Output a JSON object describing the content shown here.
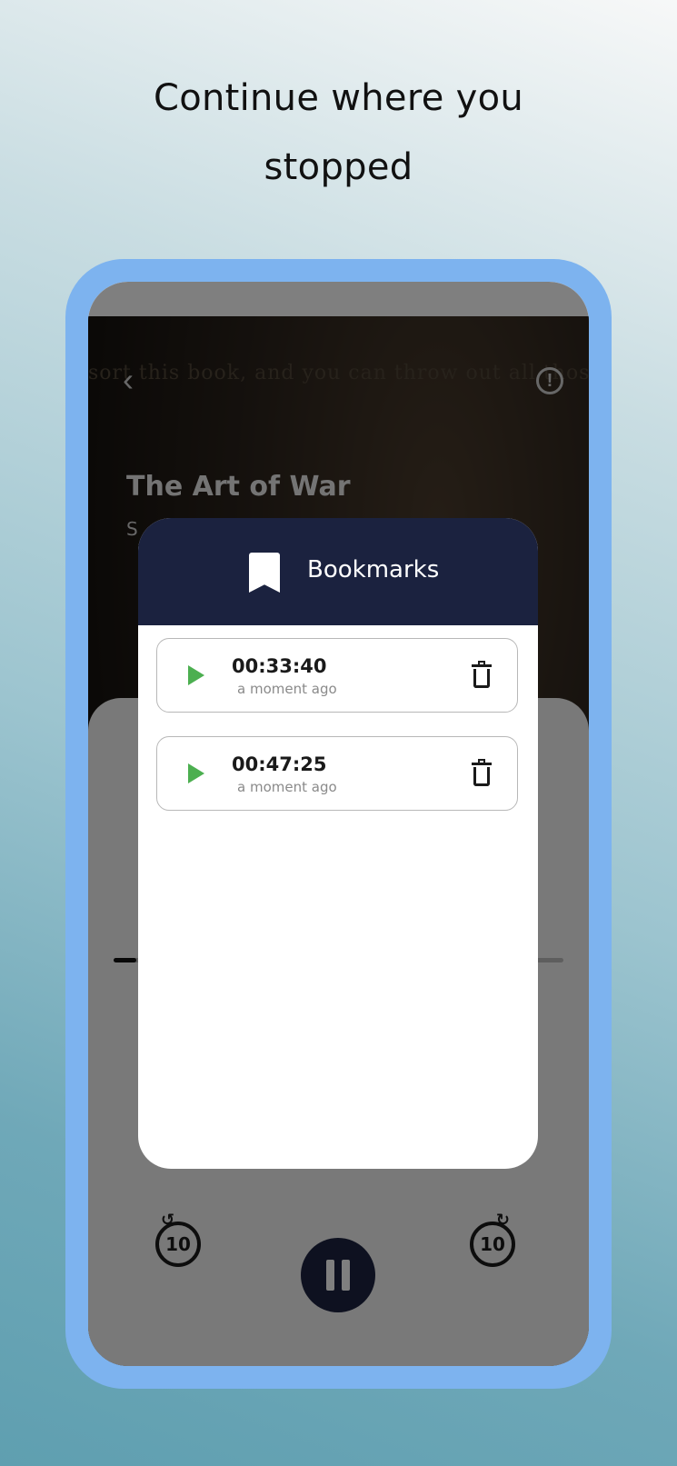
{
  "headline": {
    "line1": "Continue where you",
    "line2": "stopped"
  },
  "player": {
    "cover_text": "sort this book, and you can throw out all those",
    "book_title": "The Art of War",
    "book_author": "S",
    "progress": 0.05,
    "rewind_label": "10",
    "forward_label": "10"
  },
  "dialog": {
    "title": "Bookmarks",
    "items": [
      {
        "time": "00:33:40",
        "ago": "a moment ago"
      },
      {
        "time": "00:47:25",
        "ago": "a moment ago"
      }
    ]
  },
  "colors": {
    "accent_green": "#4caf50",
    "header_navy": "#1b223f",
    "frame_blue": "#7db3ef"
  }
}
